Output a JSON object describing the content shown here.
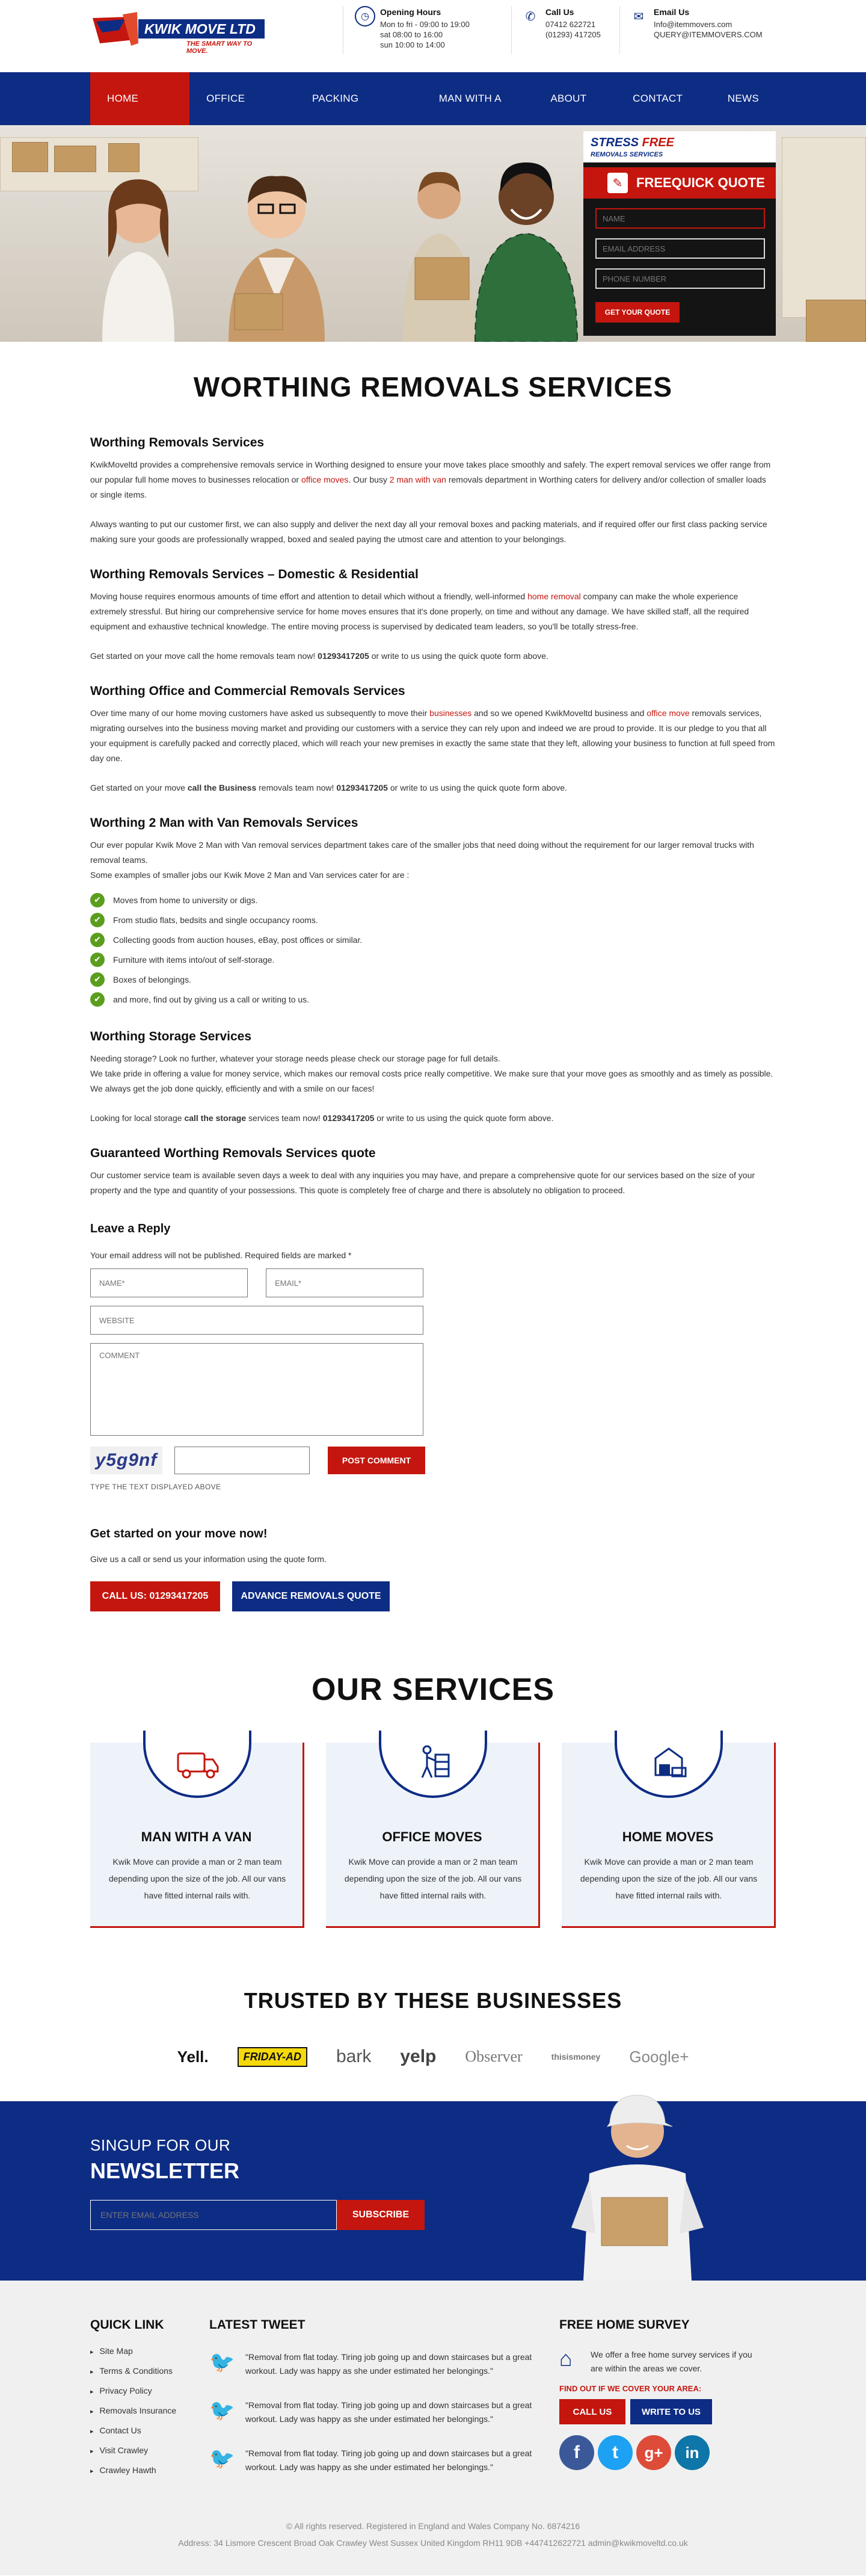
{
  "brand": {
    "name": "KWIK MOVE LTD",
    "tagline": "THE SMART WAY TO MOVE."
  },
  "header": {
    "hours": {
      "title": "Opening Hours",
      "lines": [
        "Mon to fri - 09:00 to 19:00",
        "sat 08:00 to 16:00",
        "sun 10:00 to 14:00"
      ]
    },
    "call": {
      "title": "Call Us",
      "lines": [
        "07412 622721",
        "(01293) 417205"
      ]
    },
    "email": {
      "title": "Email Us",
      "lines": [
        "Info@itemmovers.com",
        "QUERY@ITEMMOVERS.COM"
      ]
    }
  },
  "nav": [
    "HOME MOVES",
    "OFFICE MOVES",
    "PACKING SERVICES",
    "MAN WITH A VAN",
    "ABOUT US",
    "CONTACT US",
    "NEWS"
  ],
  "quote_form": {
    "stress": "STRESS",
    "free": "FREE",
    "subtitle": "REMOVALS SERVICES",
    "title": "FREEQUICK QUOTE",
    "name_ph": "NAME",
    "email_ph": "EMAIL ADDRESS",
    "phone_ph": "PHONE NUMBER",
    "button": "GET YOUR QUOTE"
  },
  "page_title": "WORTHING REMOVALS SERVICES",
  "sections": {
    "s1": {
      "h": "Worthing Removals Services",
      "p1a": "KwikMoveltd provides a comprehensive removals service in Worthing designed to ensure your move takes place smoothly and safely. The expert removal services we offer range from our popular full home moves to businesses relocation or ",
      "p1link": "office moves",
      "p1b": ". Our busy ",
      "p1link2": "2 man with van",
      "p1c": " removals department in Worthing caters for delivery and/or collection of smaller loads or single items.",
      "p2": "Always wanting to put our customer first, we can also supply and deliver the next day all your removal boxes and packing materials, and if required offer our first class packing service making sure your goods are professionally wrapped, boxed and sealed paying the utmost care and attention to your belongings."
    },
    "s2": {
      "h": "Worthing Removals Services – Domestic & Residential",
      "p1a": "Moving house requires enormous amounts of time effort and attention to detail which without a friendly, well-informed ",
      "p1link": "home removal",
      "p1b": " company can make the whole experience extremely stressful. But hiring our comprehensive service for home moves ensures that it's done properly, on time and without any damage. We have skilled staff, all the required equipment and exhaustive technical knowledge. The entire moving process is supervised by dedicated team leaders, so you'll be totally stress-free.",
      "p2a": "Get started on your move call the home removals team now! ",
      "p2b": "01293417205",
      "p2c": " or write to us using the quick quote form above."
    },
    "s3": {
      "h": "Worthing Office and Commercial Removals Services",
      "p1a": "Over time many of our home moving customers have asked us subsequently to move their ",
      "p1link": "businesses",
      "p1b": " and so we opened KwikMoveltd business and ",
      "p1link2": "office move",
      "p1c": " removals services, migrating ourselves into the business moving market and providing our customers with a service they can rely upon and indeed we are proud to provide. It is our pledge to you that all your equipment is carefully packed and correctly placed, which will reach your new premises in exactly the same state that they left, allowing your business to function at full speed from day one.",
      "p2a": "Get started on your move ",
      "p2b": "call the Business",
      "p2c": " removals team now! ",
      "p2d": "01293417205",
      "p2e": " or write to us using the quick quote form above."
    },
    "s4": {
      "h": "Worthing 2 Man with Van Removals Services",
      "p1": "Our ever popular Kwik Move 2 Man with Van removal services department takes care of the smaller jobs that need doing without the requirement for our larger removal trucks with removal teams.",
      "p2": "Some examples of smaller jobs our Kwik Move 2 Man and Van services cater for are :",
      "items": [
        "Moves from home to university or digs.",
        "From studio flats, bedsits and single occupancy rooms.",
        "Collecting goods from auction houses, eBay, post offices or similar.",
        "Furniture with items into/out of self-storage.",
        "Boxes of belongings.",
        "and more, find out by giving us a call or writing to us."
      ]
    },
    "s5": {
      "h": "Worthing Storage Services",
      "p1": "Needing storage? Look no further, whatever your storage needs please check our storage page for full details.",
      "p2": "We take pride in offering a value for money service, which makes our removal costs price really competitive. We make sure that your move goes as smoothly and as timely as possible. We always get the job done quickly, efficiently and with a smile on our faces!",
      "p3a": "Looking for local storage ",
      "p3b": "call the storage",
      "p3c": " services team now! ",
      "p3d": "01293417205",
      "p3e": " or write to us using the quick quote form above."
    },
    "s6": {
      "h": "Guaranteed Worthing Removals Services quote",
      "p1": "Our customer service team is available seven days a week to deal with any inquiries you may have, and prepare a comprehensive quote for our services based on the size of your property and the type and quantity of your possessions. This quote is completely free of charge and there is absolutely no obligation to proceed."
    }
  },
  "reply": {
    "title": "Leave a Reply",
    "note": "Your email address will not be published. Required fields are marked *",
    "name_ph": "NAME*",
    "email_ph": "EMAIL*",
    "website_ph": "WEBSITE",
    "comment_ph": "COMMENT",
    "captcha": "y5g9nf",
    "post": "POST COMMENT",
    "captcha_label": "TYPE THE TEXT DISPLAYED ABOVE"
  },
  "getstarted": {
    "title": "Get started on your move now!",
    "text": "Give us a call or send us your information using the quote form.",
    "call_btn": "CALL US: 01293417205",
    "quote_btn": "ADVANCE REMOVALS QUOTE"
  },
  "services": {
    "title": "OUR SERVICES",
    "cards": [
      {
        "title": "MAN WITH A VAN",
        "text": "Kwik Move can provide a man or 2 man team depending upon the size of the job. All our vans have fitted internal rails with.",
        "icon": "van-icon"
      },
      {
        "title": "OFFICE MOVES",
        "text": "Kwik Move can provide a man or 2 man team depending upon the size of the job. All our vans have fitted internal rails with.",
        "icon": "office-move-icon"
      },
      {
        "title": "HOME MOVES",
        "text": "Kwik Move can provide a man or 2 man team depending upon the size of the job. All our vans have fitted internal rails with.",
        "icon": "home-move-icon"
      }
    ]
  },
  "trusted": {
    "title": "TRUSTED BY THESE BUSINESSES",
    "logos": [
      "Yell.",
      "FRIDAY-AD",
      "bark",
      "yelp",
      "Observer",
      "thisismoney",
      "Google+"
    ]
  },
  "newsletter": {
    "line1": "SINGUP FOR OUR",
    "line2": "NEWSLETTER",
    "placeholder": "ENTER EMAIL ADDRESS",
    "button": "SUBSCRIBE"
  },
  "footer": {
    "quick_title": "QUICK LINK",
    "links": [
      "Site Map",
      "Terms & Conditions",
      "Privacy Policy",
      "Removals Insurance",
      "Contact Us",
      "Visit Crawley",
      "Crawley Hawth"
    ],
    "tweet_title": "LATEST TWEET",
    "tweets": [
      "\"Removal from flat today. Tiring job going up and down staircases but a great workout. Lady was happy as she under estimated her belongings.\"",
      "\"Removal from flat today. Tiring job going up and down staircases but a great workout. Lady was happy as she under estimated her belongings.\"",
      "\"Removal from flat today. Tiring job going up and down staircases but a great workout. Lady was happy as she under estimated her belongings.\""
    ],
    "survey_title": "FREE HOME SURVEY",
    "survey_text": "We offer a free home survey services if you are within the areas we cover.",
    "find_out": "FIND OUT IF WE COVER YOUR AREA:",
    "call_btn": "CALL US",
    "write_btn": "WRITE TO US",
    "social": [
      "f",
      "t",
      "g+",
      "in"
    ],
    "copyright": "© All rights reserved. Registered in England and Wales Company No. 6874216",
    "address": "Address: 34 Lismore Crescent Broad Oak Crawley West Sussex United Kingdom RH11 9DB +447412622721 admin@kwikmoveltd.co.uk"
  },
  "colors": {
    "navy": "#0d2c84",
    "red": "#c4160e",
    "green": "#5b9e1e"
  }
}
